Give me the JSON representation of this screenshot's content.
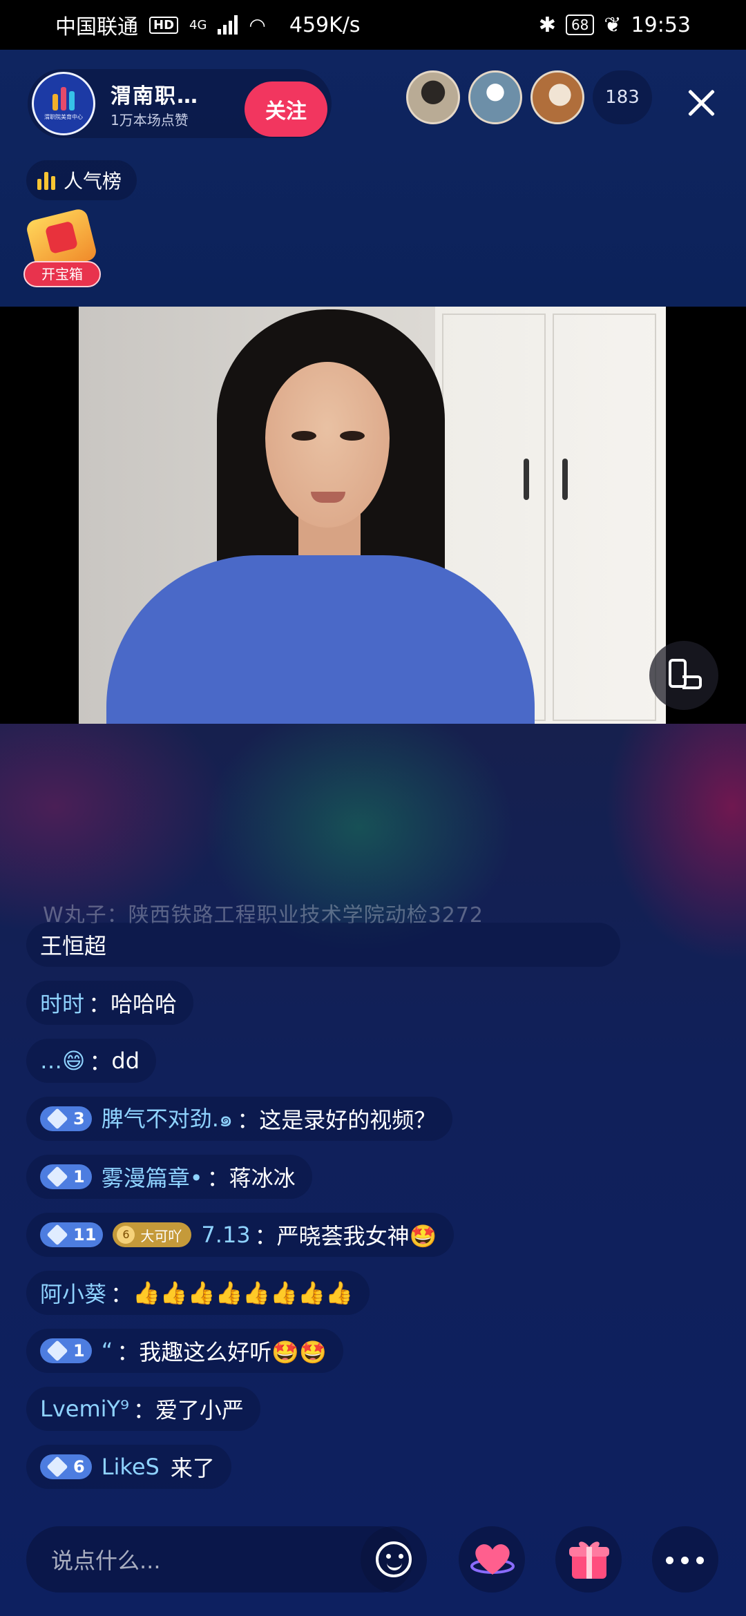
{
  "status_bar": {
    "carrier": "中国联通",
    "hd": "HD",
    "network": "4G",
    "speed": "459K/s",
    "battery": "68",
    "time": "19:53"
  },
  "header": {
    "host_name": "渭南职…",
    "host_likes": "1万本场点赞",
    "host_logo_text": "渭职院美育中心",
    "follow_label": "关注",
    "viewer_count": "183",
    "rank_label": "人气榜",
    "treasure_label": "开宝箱"
  },
  "chat": {
    "faded_line": "W丸子：陕西铁路工程职业技术学院动检3272",
    "messages": [
      {
        "name": "",
        "text": "王恒超"
      },
      {
        "name": "时时",
        "text": "哈哈哈"
      },
      {
        "name": "…😄",
        "text": "dd"
      },
      {
        "level": "3",
        "name": "脾气不对劲.๑",
        "text": "这是录好的视频？"
      },
      {
        "level": "1",
        "name": "雾漫篇章•",
        "text": "蒋冰冰"
      },
      {
        "level": "11",
        "fan_level": "6",
        "fan_name": "大可吖",
        "name": "7.13",
        "text": "严晓荟我女神🤩"
      },
      {
        "name": "阿小葵",
        "text": "👍👍👍👍👍👍👍👍"
      },
      {
        "level": "1",
        "name": "“",
        "text": "我趣这么好听🤩🤩"
      },
      {
        "name": "LvemiY⁹",
        "text": "爱了小严"
      },
      {
        "level": "6",
        "name": "LikeS",
        "text": "来了"
      }
    ]
  },
  "footer": {
    "input_placeholder": "说点什么..."
  },
  "colors": {
    "follow": "#f2365f",
    "chat_name": "#8fd3ff",
    "level_badge": "#4d7de0",
    "background": "#0b1e55"
  }
}
